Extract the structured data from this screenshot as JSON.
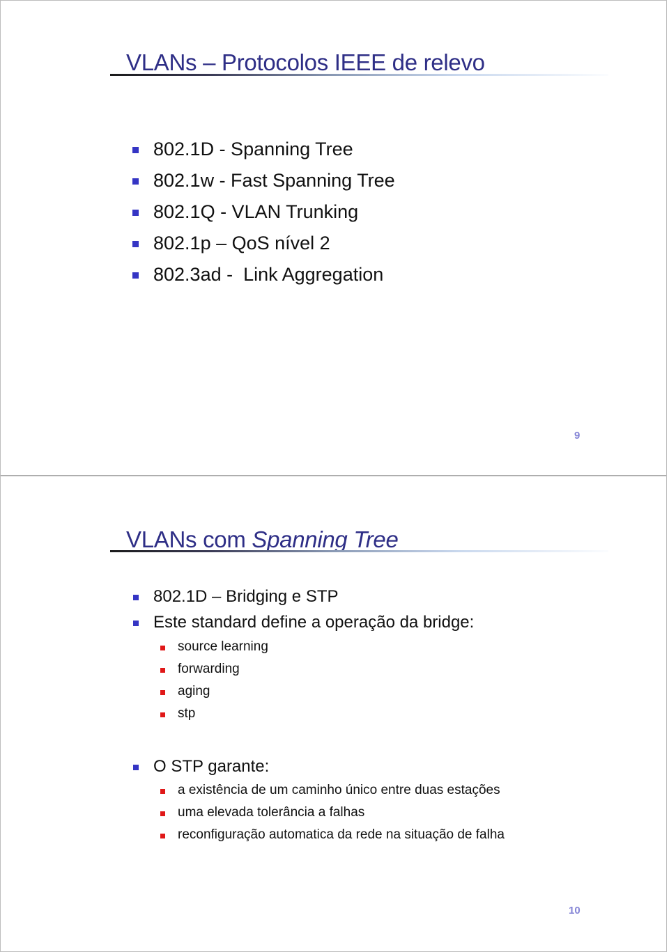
{
  "slides": [
    {
      "title": "VLANs – Protocolos IEEE de relevo",
      "bullets": [
        "802.1D - Spanning Tree",
        "802.1w - Fast Spanning Tree",
        "802.1Q - VLAN Trunking",
        "802.1p – QoS nível 2",
        "802.3ad -  Link Aggregation"
      ],
      "page_number": "9"
    },
    {
      "title_plain": "VLANs com ",
      "title_italic": "Spanning Tree",
      "bullets": [
        {
          "text": "802.1D – Bridging e STP",
          "sub": []
        },
        {
          "text": "Este standard define a operação da bridge:",
          "sub": [
            "source learning",
            "forwarding",
            "aging",
            "stp"
          ]
        },
        {
          "text": "O STP garante:",
          "sub": [
            "a existência de um caminho único entre duas estações",
            "uma elevada tolerância a falhas",
            "reconfiguração automatica da rede na situação de falha"
          ]
        }
      ],
      "page_number": "10"
    }
  ],
  "colors": {
    "title": "#2e2e86",
    "bullet_level1": "#3535c4",
    "bullet_level2": "#e01818",
    "page_number": "#8585d6"
  }
}
